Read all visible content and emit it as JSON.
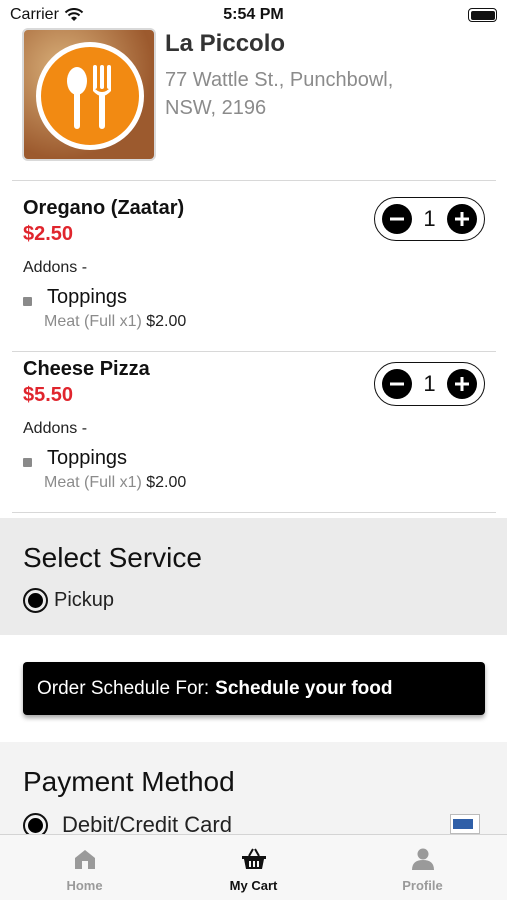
{
  "status_bar": {
    "carrier": "Carrier",
    "time": "5:54 PM"
  },
  "restaurant": {
    "name": "La Piccolo",
    "address_line1": "77 Wattle St., Punchbowl,",
    "address_line2": "NSW, 2196"
  },
  "cart_items": [
    {
      "name": "Oregano (Zaatar)",
      "price": "$2.50",
      "quantity": "1",
      "addons_label": "Addons -",
      "addon_name": "Toppings",
      "addon_detail": "Meat (Full x1)",
      "addon_price": "$2.00"
    },
    {
      "name": "Cheese Pizza",
      "price": "$5.50",
      "quantity": "1",
      "addons_label": "Addons -",
      "addon_name": "Toppings",
      "addon_detail": "Meat (Full x1)",
      "addon_price": "$2.00"
    }
  ],
  "service": {
    "title": "Select Service",
    "option": "Pickup"
  },
  "schedule": {
    "prefix": "Order Schedule For:",
    "value": "Schedule your food"
  },
  "payment": {
    "title": "Payment Method",
    "option": "Debit/Credit Card"
  },
  "tabs": [
    {
      "label": "Home",
      "icon": "home-icon"
    },
    {
      "label": "My Cart",
      "icon": "basket-icon",
      "active": true
    },
    {
      "label": "Profile",
      "icon": "person-icon"
    }
  ],
  "colors": {
    "price": "#e0252d",
    "logo_accent": "#f28a12"
  }
}
